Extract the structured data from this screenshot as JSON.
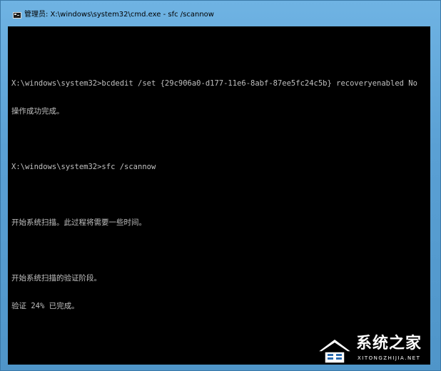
{
  "window": {
    "title": "管理员: X:\\windows\\system32\\cmd.exe - sfc  /scannow"
  },
  "console": {
    "lines": [
      "",
      "X:\\windows\\system32>bcdedit /set {29c906a0-d177-11e6-8abf-87ee5fc24c5b} recoveryenabled No",
      "操作成功完成。",
      "",
      "X:\\windows\\system32>sfc /scannow",
      "",
      "开始系统扫描。此过程将需要一些时间。",
      "",
      "开始系统扫描的验证阶段。",
      "验证 24% 已完成。"
    ]
  },
  "watermark": {
    "brand": "系统之家",
    "sub": "XITONGZHIJIA.NET"
  },
  "colors": {
    "console_bg": "#000000",
    "console_text": "#c0c0c0",
    "frame": "#5aa0d4"
  }
}
